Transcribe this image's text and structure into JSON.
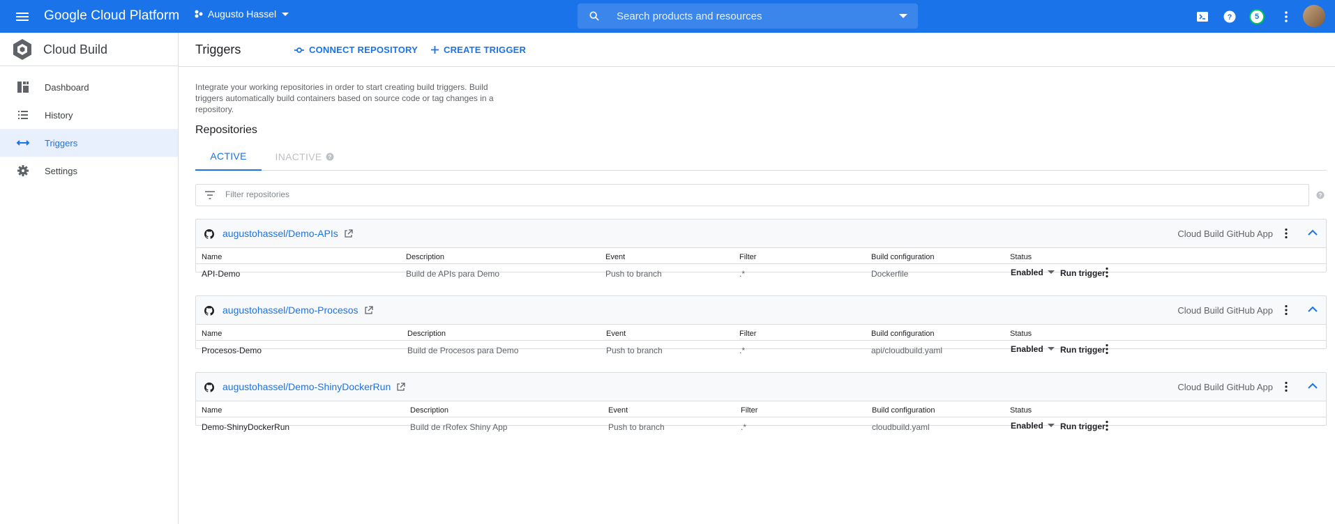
{
  "topbar": {
    "brand": "Google Cloud Platform",
    "project": "Augusto Hassel",
    "search_placeholder": "Search products and resources",
    "notifications_count": "5"
  },
  "sidebar": {
    "product": "Cloud Build",
    "items": [
      {
        "label": "Dashboard",
        "icon": "dashboard-icon"
      },
      {
        "label": "History",
        "icon": "list-icon"
      },
      {
        "label": "Triggers",
        "icon": "arrows-icon"
      },
      {
        "label": "Settings",
        "icon": "gear-icon"
      }
    ]
  },
  "header": {
    "title": "Triggers",
    "connect": "CONNECT REPOSITORY",
    "create": "CREATE TRIGGER"
  },
  "intro": "Integrate your working repositories in order to start creating build triggers. Build triggers automatically build containers based on source code or tag changes in a repository.",
  "repos_title": "Repositories",
  "tabs": {
    "active": "ACTIVE",
    "inactive": "INACTIVE"
  },
  "filter_placeholder": "Filter repositories",
  "columns": {
    "name": "Name",
    "description": "Description",
    "event": "Event",
    "filter": "Filter",
    "build_config": "Build configuration",
    "status": "Status"
  },
  "repositories": [
    {
      "name": "augustohassel/Demo-APIs",
      "app": "Cloud Build GitHub App",
      "trigger": {
        "name": "API-Demo",
        "description": "Build de APIs para Demo",
        "event": "Push to branch",
        "filter": ".*",
        "build_config": "Dockerfile",
        "status": "Enabled",
        "run": "Run trigger"
      }
    },
    {
      "name": "augustohassel/Demo-Procesos",
      "app": "Cloud Build GitHub App",
      "trigger": {
        "name": "Procesos-Demo",
        "description": "Build de Procesos para Demo",
        "event": "Push to branch",
        "filter": ".*",
        "build_config": "api/cloudbuild.yaml",
        "status": "Enabled",
        "run": "Run trigger"
      }
    },
    {
      "name": "augustohassel/Demo-ShinyDockerRun",
      "app": "Cloud Build GitHub App",
      "trigger": {
        "name": "Demo-ShinyDockerRun",
        "description": "Build de rRofex Shiny App",
        "event": "Push to branch",
        "filter": ".*",
        "build_config": "cloudbuild.yaml",
        "status": "Enabled",
        "run": "Run trigger"
      }
    }
  ],
  "colors": {
    "brand": "#1a73e8",
    "sidebar_active_bg": "#e8f0fe",
    "border": "#dadce0"
  }
}
